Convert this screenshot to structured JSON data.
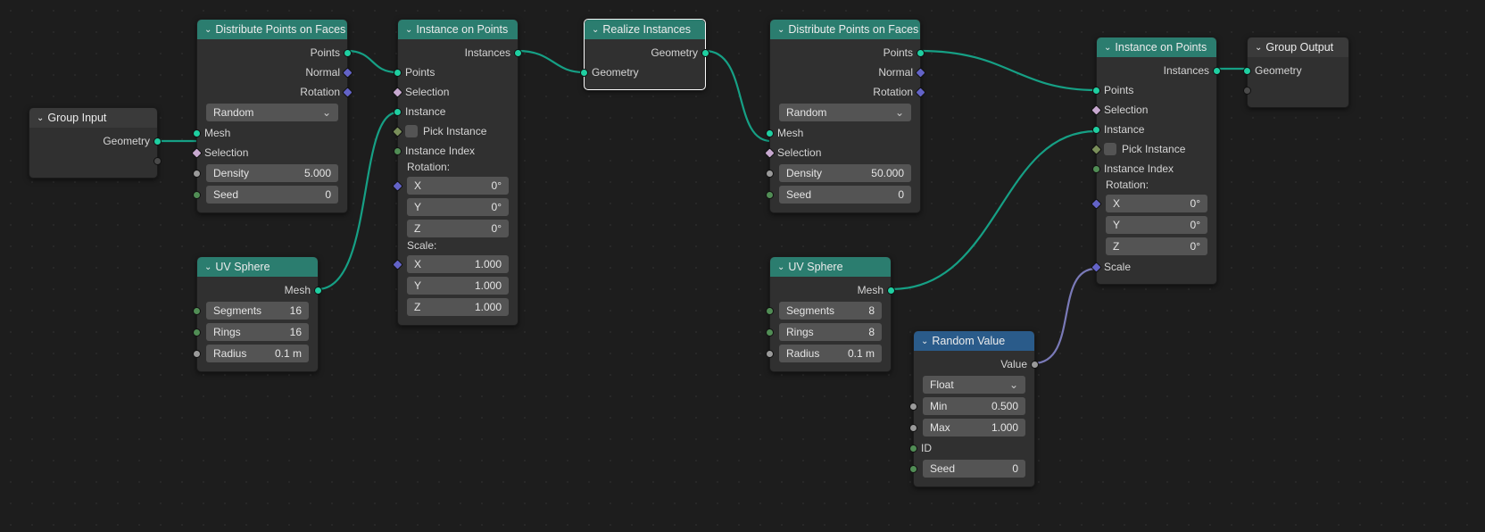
{
  "groupInput": {
    "title": "Group Input",
    "geometry": "Geometry"
  },
  "dist1": {
    "title": "Distribute Points on Faces",
    "points": "Points",
    "normal": "Normal",
    "rotation": "Rotation",
    "mesh": "Mesh",
    "selection": "Selection",
    "mode": "Random",
    "density_lbl": "Density",
    "density_val": "5.000",
    "seed_lbl": "Seed",
    "seed_val": "0"
  },
  "uv1": {
    "title": "UV Sphere",
    "mesh": "Mesh",
    "segments_lbl": "Segments",
    "segments_val": "16",
    "rings_lbl": "Rings",
    "rings_val": "16",
    "radius_lbl": "Radius",
    "radius_val": "0.1 m"
  },
  "inst1": {
    "title": "Instance on Points",
    "instances": "Instances",
    "points": "Points",
    "selection": "Selection",
    "instance": "Instance",
    "pick": "Pick Instance",
    "index": "Instance Index",
    "rotation_lbl": "Rotation:",
    "rx_l": "X",
    "rx_v": "0°",
    "ry_l": "Y",
    "ry_v": "0°",
    "rz_l": "Z",
    "rz_v": "0°",
    "scale_lbl": "Scale:",
    "sx_l": "X",
    "sx_v": "1.000",
    "sy_l": "Y",
    "sy_v": "1.000",
    "sz_l": "Z",
    "sz_v": "1.000"
  },
  "realize": {
    "title": "Realize Instances",
    "geometry_out": "Geometry",
    "geometry_in": "Geometry"
  },
  "dist2": {
    "title": "Distribute Points on Faces",
    "points": "Points",
    "normal": "Normal",
    "rotation": "Rotation",
    "mesh": "Mesh",
    "selection": "Selection",
    "mode": "Random",
    "density_lbl": "Density",
    "density_val": "50.000",
    "seed_lbl": "Seed",
    "seed_val": "0"
  },
  "uv2": {
    "title": "UV Sphere",
    "mesh": "Mesh",
    "segments_lbl": "Segments",
    "segments_val": "8",
    "rings_lbl": "Rings",
    "rings_val": "8",
    "radius_lbl": "Radius",
    "radius_val": "0.1 m"
  },
  "rand": {
    "title": "Random Value",
    "value": "Value",
    "type": "Float",
    "min_lbl": "Min",
    "min_val": "0.500",
    "max_lbl": "Max",
    "max_val": "1.000",
    "id": "ID",
    "seed_lbl": "Seed",
    "seed_val": "0"
  },
  "inst2": {
    "title": "Instance on Points",
    "instances": "Instances",
    "points": "Points",
    "selection": "Selection",
    "instance": "Instance",
    "pick": "Pick Instance",
    "index": "Instance Index",
    "rotation_lbl": "Rotation:",
    "rx_l": "X",
    "rx_v": "0°",
    "ry_l": "Y",
    "ry_v": "0°",
    "rz_l": "Z",
    "rz_v": "0°",
    "scale": "Scale"
  },
  "groupOutput": {
    "title": "Group Output",
    "geometry": "Geometry"
  }
}
